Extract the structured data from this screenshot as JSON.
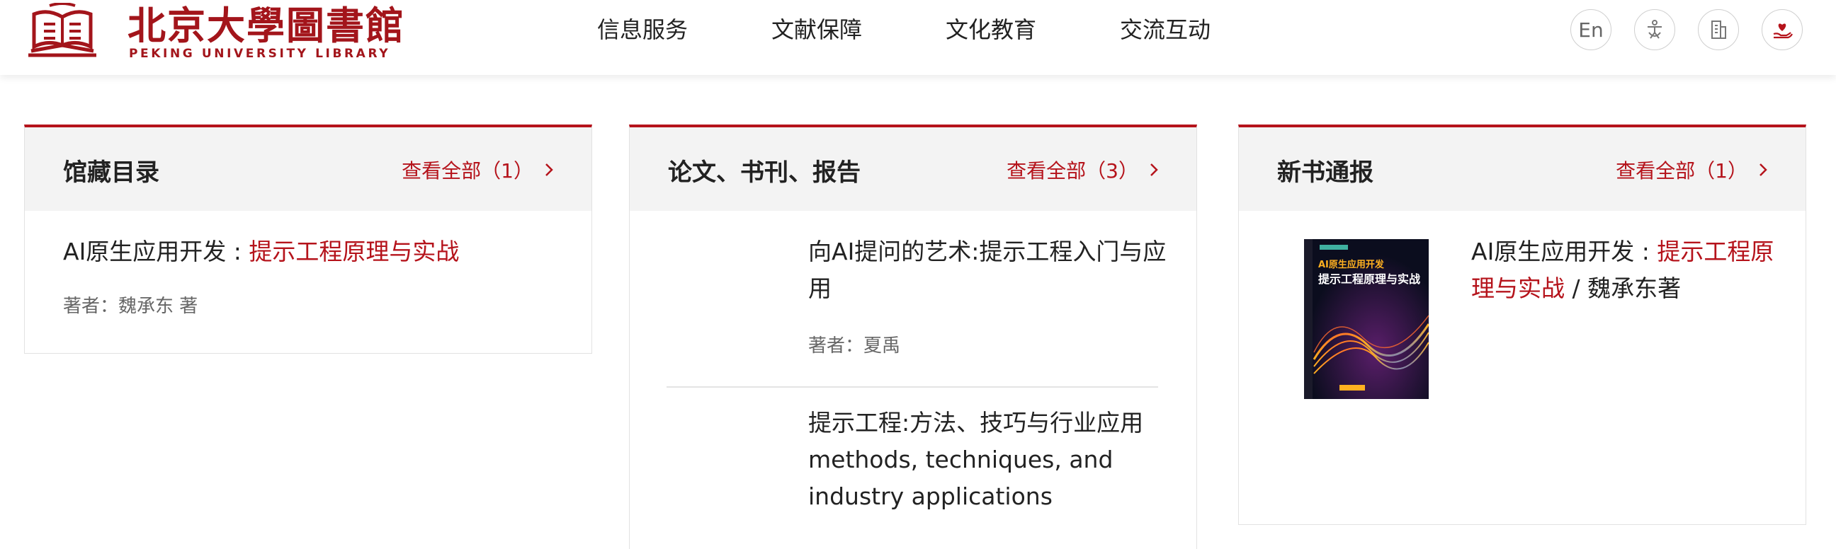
{
  "header": {
    "logo_cn": "北京大學圖書館",
    "logo_en": "PEKING UNIVERSITY LIBRARY",
    "nav": [
      "信息服务",
      "文献保障",
      "文化教育",
      "交流互动"
    ],
    "tools": {
      "lang_label": "En",
      "icons": [
        "language-icon",
        "accessibility-icon",
        "building-icon",
        "donate-heart-icon"
      ]
    }
  },
  "cards": {
    "catalog": {
      "title": "馆藏目录",
      "more": "查看全部（1）",
      "item": {
        "title_prefix": "AI原生应用开发 : ",
        "title_link": "提示工程原理与实战",
        "author": "著者：魏承东 著"
      }
    },
    "papers": {
      "title": "论文、书刊、报告",
      "more": "查看全部（3）",
      "items": [
        {
          "title": "向AI提问的艺术:提示工程入门与应用",
          "author": "著者：夏禹"
        },
        {
          "title": "提示工程:方法、技巧与行业应用 methods, techniques, and industry applications"
        }
      ]
    },
    "new_books": {
      "title": "新书通报",
      "more": "查看全部（1）",
      "item": {
        "title_prefix": "AI原生应用开发 : ",
        "title_link": "提示工程原理与实战",
        "title_suffix": " / 魏承东著",
        "cover_lines": [
          "AI原生应用开发",
          "提示工程原理与实战"
        ]
      }
    }
  },
  "colors": {
    "accent": "#b5131b",
    "logo": "#a3151b",
    "head_bg": "#f3f3f3"
  }
}
